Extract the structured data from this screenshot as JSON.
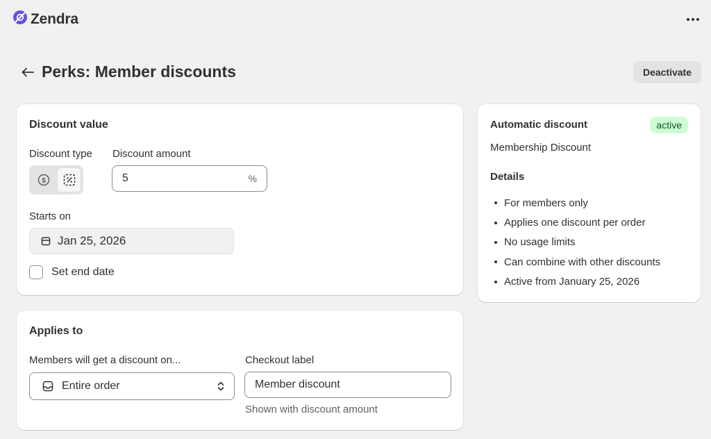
{
  "brand": {
    "name": "Zendra",
    "accent": "#6b4fe0"
  },
  "header": {
    "title": "Perks: Member discounts",
    "deactivate_label": "Deactivate"
  },
  "discount_value": {
    "title": "Discount value",
    "type_label": "Discount type",
    "type_options": [
      "dollar-icon",
      "percent-icon"
    ],
    "type_selected": "percent-icon",
    "amount_label": "Discount amount",
    "amount_value": "5",
    "amount_suffix": "%",
    "starts_label": "Starts on",
    "starts_value": "Jan 25, 2026",
    "end_date_label": "Set end date",
    "end_date_checked": false
  },
  "applies_to": {
    "title": "Applies to",
    "scope_label": "Members will get a discount on...",
    "scope_value": "Entire order",
    "checkout_label": "Checkout label",
    "checkout_value": "Member discount",
    "checkout_help": "Shown with discount amount"
  },
  "summary": {
    "title": "Automatic discount",
    "status": "active",
    "status_bg": "#cdfed3",
    "status_color": "#0c5132",
    "name": "Membership Discount",
    "details_title": "Details",
    "details": [
      "For members only",
      "Applies one discount per order",
      "No usage limits",
      "Can combine with other discounts",
      "Active from January 25, 2026"
    ]
  }
}
